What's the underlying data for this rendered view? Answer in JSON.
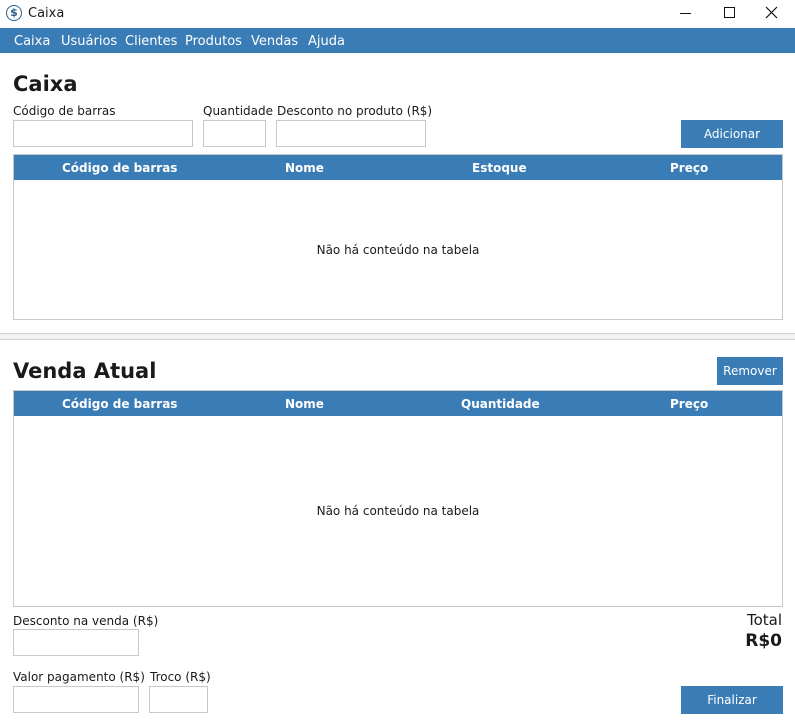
{
  "window": {
    "title": "Caixa",
    "icon": "dollar-icon"
  },
  "menu": [
    "Caixa",
    "Usuários",
    "Clientes",
    "Produtos",
    "Vendas",
    "Ajuda"
  ],
  "caixa": {
    "title": "Caixa",
    "barcode_label": "Código de barras",
    "barcode_value": "",
    "quantity_label": "Quantidade",
    "quantity_value": "",
    "discount_label": "Desconto no produto (R$)",
    "discount_value": "",
    "add_button": "Adicionar",
    "table": {
      "columns": [
        "Código de barras",
        "Nome",
        "Estoque",
        "Preço"
      ],
      "empty_message": "Não há conteúdo na tabela",
      "rows": []
    }
  },
  "venda": {
    "title": "Venda Atual",
    "remove_button": "Remover",
    "table": {
      "columns": [
        "Código de barras",
        "Nome",
        "Quantidade",
        "Preço"
      ],
      "empty_message": "Não há conteúdo na tabela",
      "rows": []
    },
    "sale_discount_label": "Desconto na venda (R$)",
    "sale_discount_value": "",
    "payment_label": "Valor pagamento (R$)",
    "payment_value": "",
    "change_label": "Troco (R$)",
    "change_value": "",
    "total_label": "Total",
    "total_value": "R$0",
    "finish_button": "Finalizar"
  },
  "colors": {
    "accent": "#3a7db6"
  }
}
